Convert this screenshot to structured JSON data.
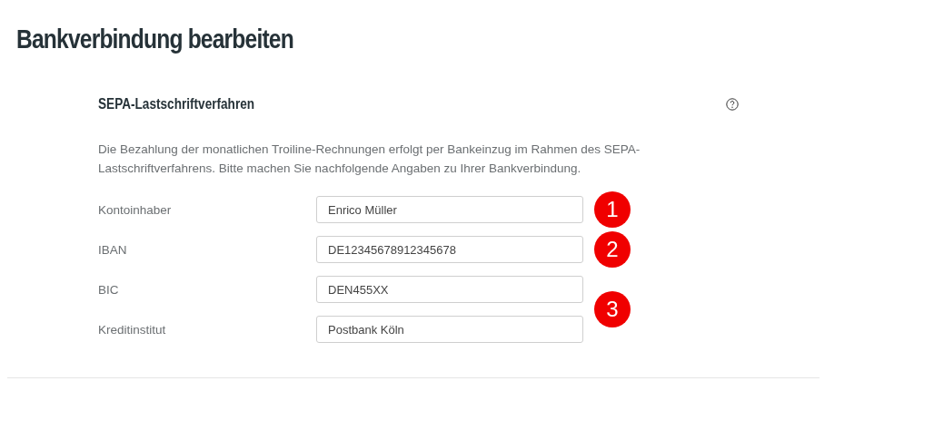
{
  "title": "Bankverbindung bearbeiten",
  "section": {
    "heading": "SEPA-Lastschriftverfahren",
    "description": "Die Bezahlung der monatlichen Troiline-Rechnungen erfolgt per Bankeinzug im Rahmen des SEPA-Lastschriftverfahrens. Bitte machen Sie nachfolgende Angaben zu Ihrer Bankverbindung.",
    "fields": [
      {
        "label": "Kontoinhaber",
        "value": "Enrico Müller"
      },
      {
        "label": "IBAN",
        "value": "DE12345678912345678"
      },
      {
        "label": "BIC",
        "value": "DEN455XX"
      },
      {
        "label": "Kreditinstitut",
        "value": "Postbank Köln"
      }
    ],
    "markers": [
      {
        "label": "1",
        "kind": "single"
      },
      {
        "label": "2",
        "kind": "single"
      },
      {
        "label": "3",
        "kind": "pair"
      }
    ]
  }
}
